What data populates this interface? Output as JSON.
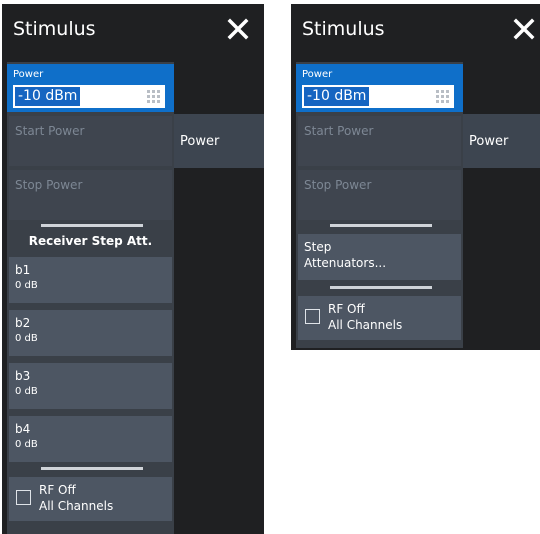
{
  "left_panel": {
    "title": "Stimulus",
    "power": {
      "label": "Power",
      "value": "-10 dBm"
    },
    "start_power": "Start Power",
    "stop_power": "Stop Power",
    "side_button": "Power",
    "section_title": "Receiver Step Att.",
    "receivers": [
      {
        "name": "b1",
        "value": "0 dB"
      },
      {
        "name": "b2",
        "value": "0 dB"
      },
      {
        "name": "b3",
        "value": "0 dB"
      },
      {
        "name": "b4",
        "value": "0 dB"
      }
    ],
    "rf_off": {
      "line1": "RF Off",
      "line2": "All Channels",
      "checked": false
    }
  },
  "right_panel": {
    "title": "Stimulus",
    "power": {
      "label": "Power",
      "value": "-10 dBm"
    },
    "start_power": "Start Power",
    "stop_power": "Stop Power",
    "side_button": "Power",
    "step_attenuators": {
      "line1": "Step",
      "line2": "Attenuators..."
    },
    "rf_off": {
      "line1": "RF Off",
      "line2": "All Channels",
      "checked": false
    }
  },
  "colors": {
    "panel_bg": "#1f2022",
    "active_field": "#0f6fc9",
    "button_bg": "#4d5663",
    "disabled_text": "#7d8794"
  }
}
